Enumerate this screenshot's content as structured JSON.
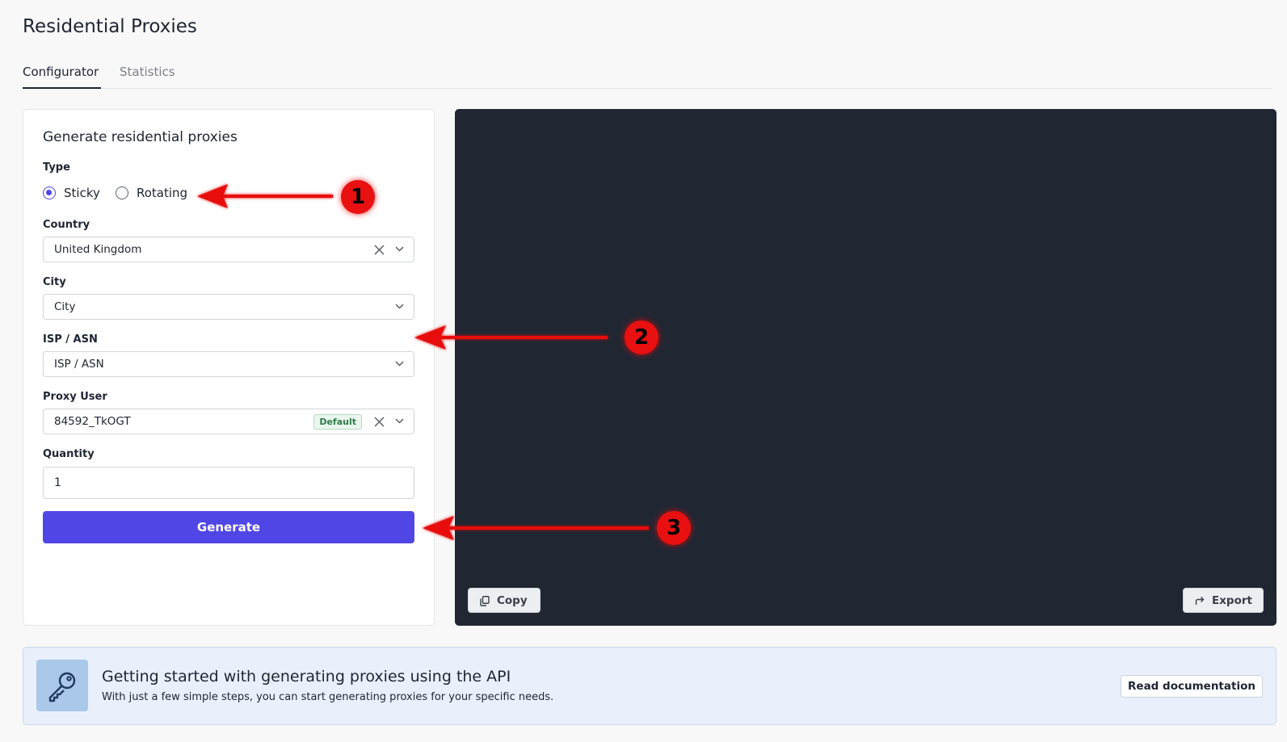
{
  "page": {
    "title": "Residential Proxies"
  },
  "tabs": [
    {
      "label": "Configurator",
      "active": true
    },
    {
      "label": "Statistics",
      "active": false
    }
  ],
  "form": {
    "title": "Generate residential proxies",
    "type": {
      "label": "Type",
      "options": [
        {
          "label": "Sticky",
          "checked": true
        },
        {
          "label": "Rotating",
          "checked": false
        }
      ]
    },
    "country": {
      "label": "Country",
      "value": "United Kingdom"
    },
    "city": {
      "label": "City",
      "placeholder": "City"
    },
    "isp": {
      "label": "ISP / ASN",
      "placeholder": "ISP / ASN"
    },
    "proxy_user": {
      "label": "Proxy User",
      "value": "84592_TkOGT",
      "badge": "Default"
    },
    "quantity": {
      "label": "Quantity",
      "value": "1"
    },
    "generate_label": "Generate"
  },
  "output": {
    "copy_label": "Copy",
    "export_label": "Export"
  },
  "banner": {
    "title": "Getting started with generating proxies using the API",
    "subtitle": "With just a few simple steps, you can start generating proxies for your specific needs.",
    "button_label": "Read documentation"
  },
  "annotations": [
    "1",
    "2",
    "3"
  ],
  "colors": {
    "accent": "#5046e5",
    "panel": "#202733",
    "annotation": "#e81010",
    "banner": "#e9f0fb"
  }
}
